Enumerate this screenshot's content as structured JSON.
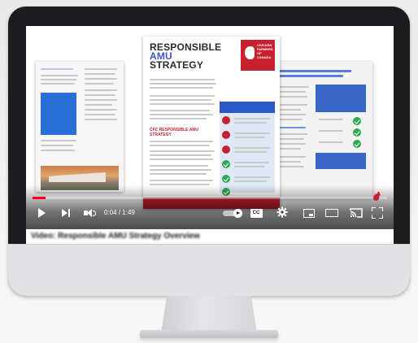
{
  "player": {
    "current_time": "0:04",
    "separator": "/",
    "duration": "1:49",
    "progress_fraction": 0.037,
    "caption_blurred": "Video: Responsible AMU Strategy Overview"
  },
  "brochure": {
    "title_line1": "RESPONSIBLE",
    "title_line2": "AMU",
    "title_line3": "STRATEGY",
    "subhead": "CFC RESPONSIBLE AMU STRATEGY",
    "logo_text": "CHICKEN FARMERS OF CANADA"
  },
  "colors": {
    "accent_red": "#c8202f",
    "accent_blue": "#2a6fd6",
    "progress_red": "#ff0000",
    "check_green": "#2fa84f"
  },
  "icons": [
    "play-icon",
    "next-icon",
    "volume-icon",
    "autoplay-icon",
    "cc-icon",
    "gear-icon",
    "miniplayer-icon",
    "theater-icon",
    "cast-icon",
    "fullscreen-icon"
  ]
}
